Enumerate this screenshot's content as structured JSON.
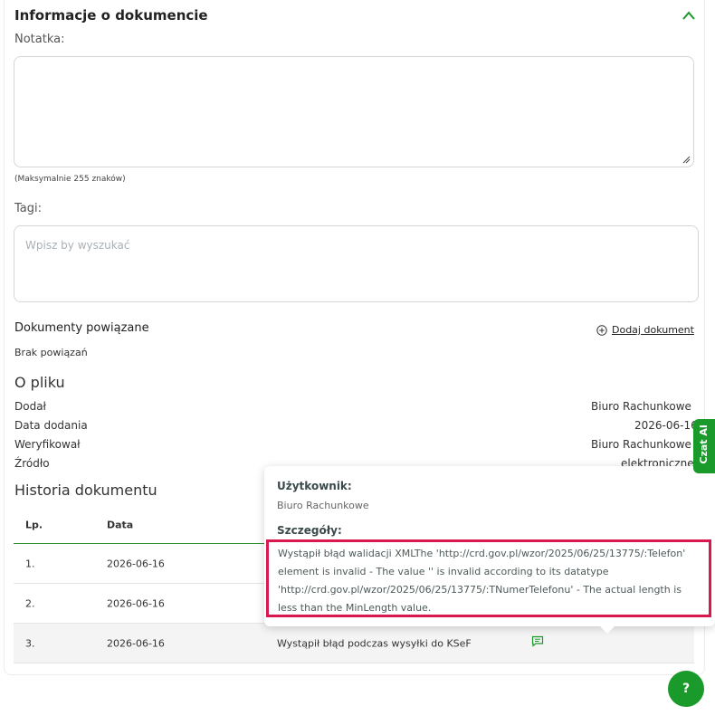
{
  "section": {
    "title": "Informacje o dokumencie"
  },
  "note": {
    "label": "Notatka:",
    "value": "",
    "hint": "(Maksymalnie 255 znaków)"
  },
  "tags": {
    "label": "Tagi:",
    "placeholder": "Wpisz by wyszukać"
  },
  "related": {
    "title": "Dokumenty powiązane",
    "empty": "Brak powiązań",
    "add_label": "Dodaj dokument"
  },
  "file": {
    "title": "O pliku",
    "rows": [
      {
        "label": "Dodał",
        "value": "Biuro Rachunkowe"
      },
      {
        "label": "Data dodania",
        "value": "2026-06-16"
      },
      {
        "label": "Weryfikował",
        "value": "Biuro Rachunkowe"
      },
      {
        "label": "Źródło",
        "value": "elektroniczne"
      }
    ]
  },
  "history": {
    "title": "Historia dokumentu",
    "columns": [
      "Lp.",
      "Data"
    ],
    "rows": [
      {
        "lp": "1.",
        "date": "2026-06-16",
        "desc": ""
      },
      {
        "lp": "2.",
        "date": "2026-06-16",
        "desc": ""
      },
      {
        "lp": "3.",
        "date": "2026-06-16",
        "desc": "Wystąpił błąd podczas wysyłki do KSeF"
      }
    ]
  },
  "tooltip": {
    "user_label": "Użytkownik:",
    "user_value": "Biuro Rachunkowe",
    "details_label": "Szczegóły:",
    "details_lines": [
      "Wystąpił błąd walidacji XMLThe 'http://crd.gov.pl/wzor/2025/06/25/13775/:Telefon'",
      "element is invalid - The value '' is invalid according to its datatype",
      "'http://crd.gov.pl/wzor/2025/06/25/13775/:TNumerTelefonu' - The actual length is",
      "less than the MinLength value."
    ]
  },
  "side_tab": {
    "label": "Czat AI"
  },
  "help": {
    "label": "?"
  },
  "colors": {
    "accent": "#1a9a2b",
    "highlight_border": "#d8184f"
  },
  "icons": {
    "collapse": "chevron-up-icon",
    "add": "plus-circle-icon",
    "comment": "message-icon"
  }
}
